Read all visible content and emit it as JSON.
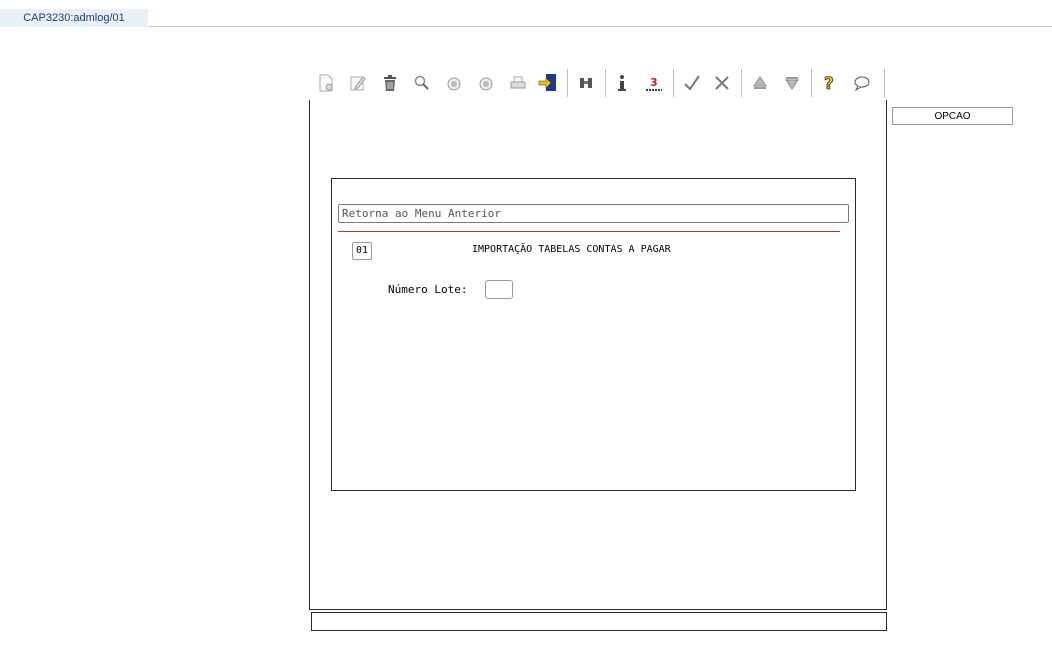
{
  "tab": {
    "label": "CAP3230:admlog/01"
  },
  "toolbar": {
    "buttons": [
      "new-icon",
      "edit-icon",
      "delete-icon",
      "search-icon",
      "previous-icon",
      "next-icon",
      "print-icon",
      "exit-icon",
      "binoculars-icon",
      "info-icon",
      "underline-3-icon",
      "confirm-icon",
      "cancel-icon",
      "up-icon",
      "down-icon",
      "help-icon",
      "comment-icon"
    ]
  },
  "side": {
    "opcao_label": "OPCAO"
  },
  "form": {
    "menu_return": "Retorna ao Menu Anterior",
    "code": "01",
    "title": "IMPORTAÇÃO TABELAS CONTAS A PAGAR",
    "lote_label": "Número Lote:",
    "lote_value": ""
  },
  "colors": {
    "accent_red": "#c0392b",
    "tab_bg": "#eaf0f7",
    "tab_text": "#1f3f73"
  }
}
